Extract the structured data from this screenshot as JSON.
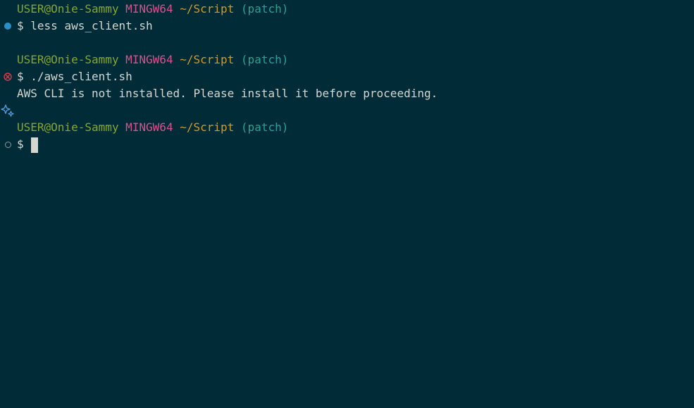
{
  "prompt": {
    "user_host": "USER@Onie-Sammy",
    "system": "MINGW64",
    "path": "~/Script",
    "branch": "(patch)",
    "symbol": "$"
  },
  "blocks": [
    {
      "status_icon": "success-dot-icon",
      "command": " less aws_client.sh",
      "output": []
    },
    {
      "status_icon": "error-circle-icon",
      "command": " ./aws_client.sh",
      "output": [
        "AWS CLI is not installed. Please install it before proceeding."
      ]
    },
    {
      "status_icon": "pending-circle-icon",
      "command": " ",
      "output": []
    }
  ],
  "colors": {
    "background": "#012b36",
    "foreground": "#d6d6d0",
    "user": "#89a62a",
    "system": "#d5538f",
    "path": "#cf9b2a",
    "branch": "#2aa198",
    "success": "#2a8fc7",
    "error": "#dc3c4d",
    "sparkle": "#5a9fe0"
  }
}
